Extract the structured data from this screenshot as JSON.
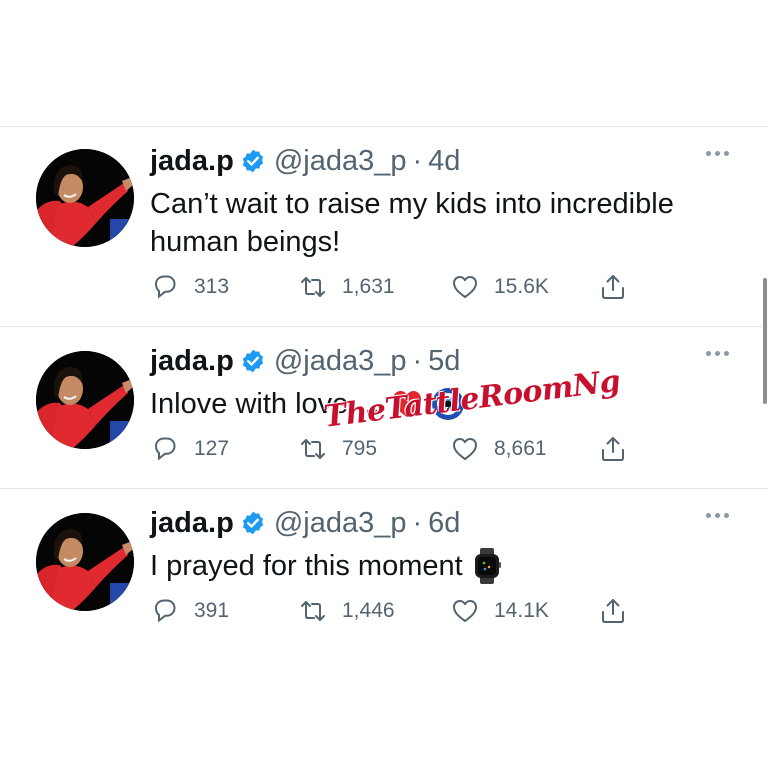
{
  "watermark": "TheTattleRoomNg",
  "colors": {
    "verified": "#1d9bf0",
    "text": "#0f1419",
    "muted": "#536471"
  },
  "tweets": [
    {
      "name": "jada.p",
      "handle": "@jada3_p",
      "separator": "·",
      "time": "4d",
      "text": "Can’t wait to raise my kids into incredible human beings!",
      "emojis": [],
      "replies": "313",
      "retweets": "1,631",
      "likes": "15.6K"
    },
    {
      "name": "jada.p",
      "handle": "@jada3_p",
      "separator": "·",
      "time": "5d",
      "text": "Inlove with love ...",
      "emojis": [
        "red-heart",
        "nazar-amulet"
      ],
      "replies": "127",
      "retweets": "795",
      "likes": "8,661"
    },
    {
      "name": "jada.p",
      "handle": "@jada3_p",
      "separator": "·",
      "time": "6d",
      "text": "I prayed for this moment",
      "emojis": [
        "watch"
      ],
      "replies": "391",
      "retweets": "1,446",
      "likes": "14.1K"
    }
  ]
}
